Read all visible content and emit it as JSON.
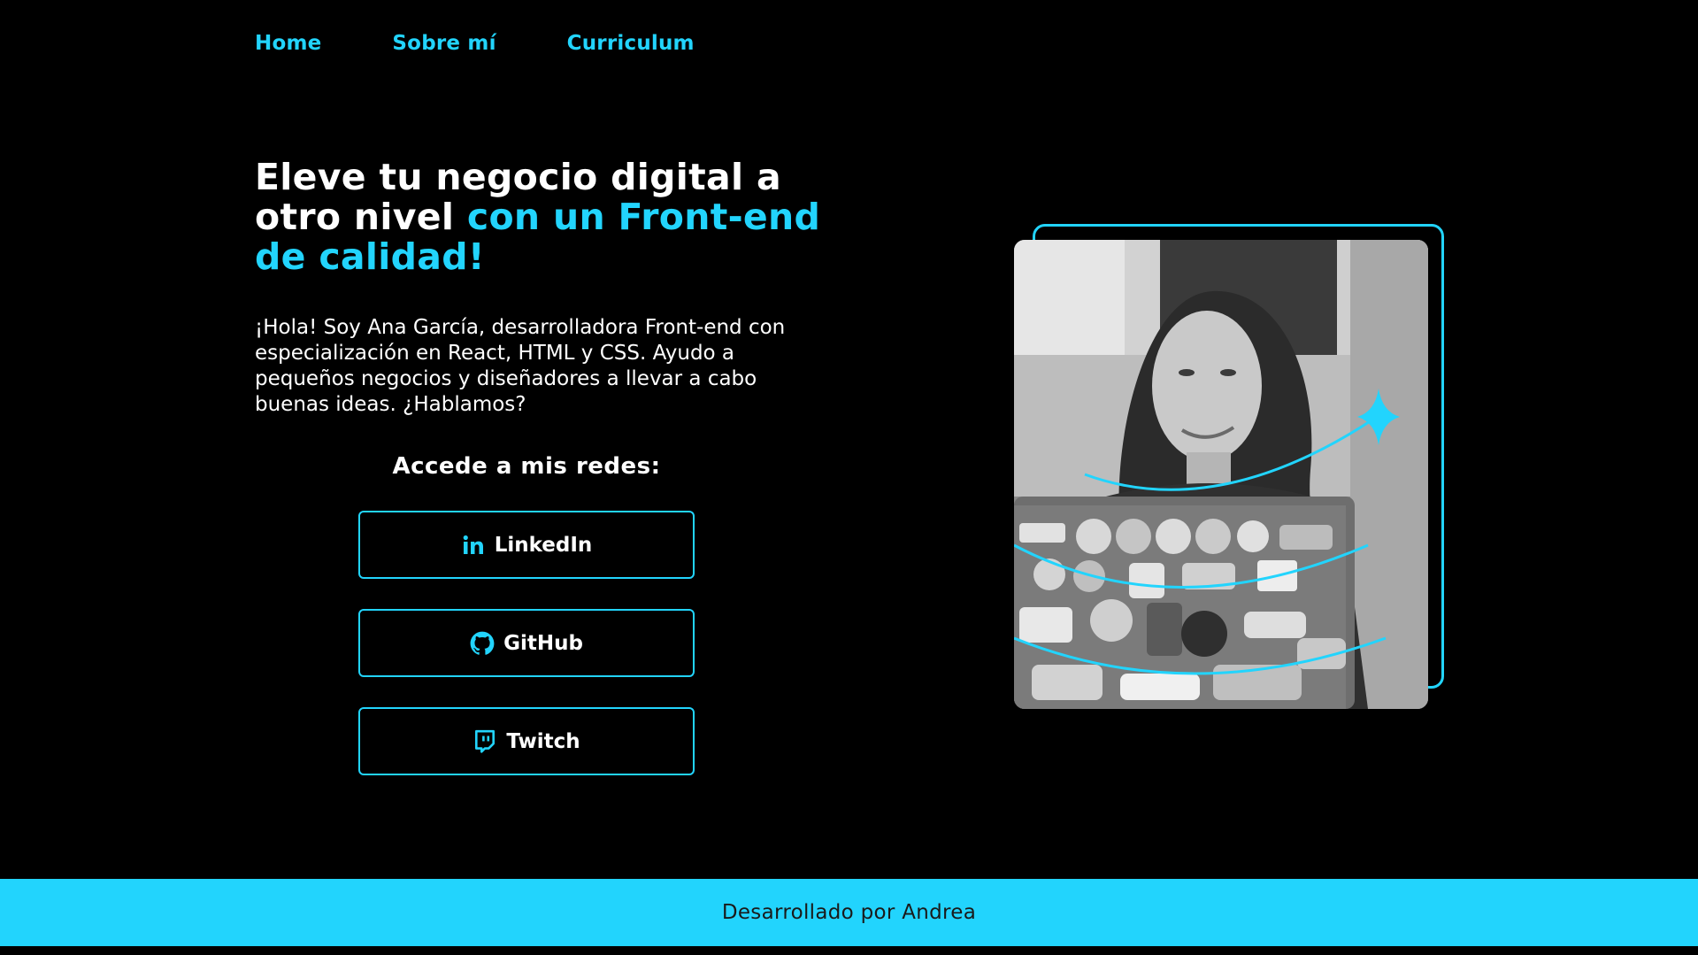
{
  "nav": {
    "items": [
      {
        "label": "Home"
      },
      {
        "label": "Sobre mí"
      },
      {
        "label": "Curriculum"
      }
    ]
  },
  "hero": {
    "headline_white": "Eleve tu negocio digital a otro nivel ",
    "headline_accent": "con un Front-end de calidad!",
    "intro": "¡Hola! Soy Ana García, desarrolladora Front-end con especialización en React, HTML y CSS. Ayudo a pequeños negocios y diseñadores a llevar a cabo buenas ideas. ¿Hablamos?",
    "social_title": "Accede a mis redes:",
    "social": [
      {
        "label": "LinkedIn",
        "icon": "linkedin-icon"
      },
      {
        "label": "GitHub",
        "icon": "github-icon"
      },
      {
        "label": "Twitch",
        "icon": "twitch-icon"
      }
    ]
  },
  "footer": {
    "text": "Desarrollado por Andrea"
  },
  "colors": {
    "accent": "#22d4fd",
    "background": "#000000",
    "text": "#ffffff"
  }
}
